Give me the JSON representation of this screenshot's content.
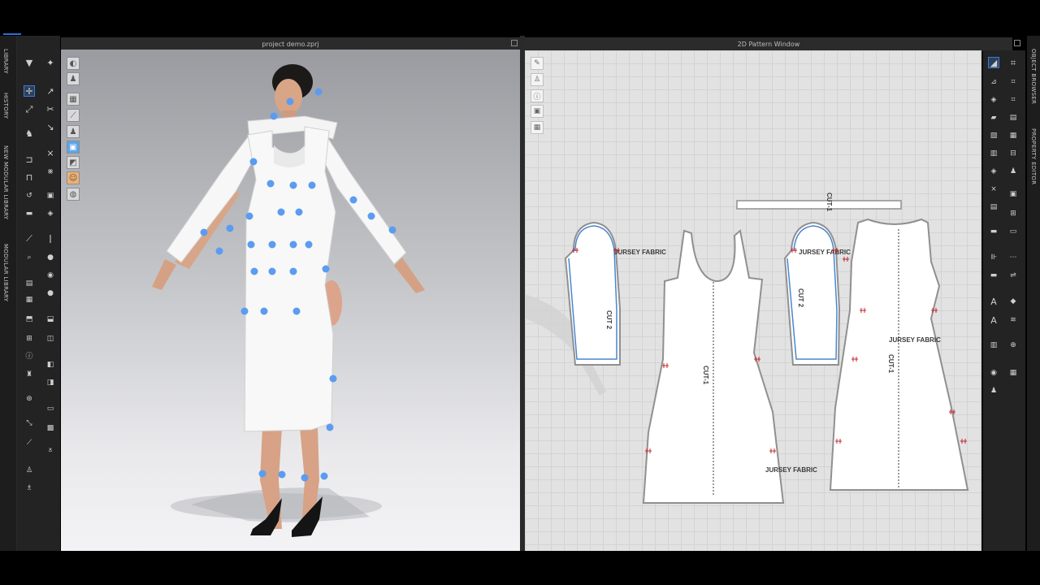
{
  "left_tabs": [
    "LIBRARY",
    "HISTORY",
    "NEW MODULAR LIBRARY",
    "MODULAR LIBRARY"
  ],
  "right_tabs": [
    "OBJECT BROWSER",
    "PROPERTY EDITOR"
  ],
  "viewport3d": {
    "title": "project demo.zprj"
  },
  "pattern_window": {
    "title": "2D Pattern Window",
    "labels": {
      "collar_cut": "CUT-1",
      "left_sleeve_fabric": "JURSEY FABRIC",
      "left_sleeve_cut": "CUT 2",
      "front_cut": "CUT-1",
      "front_fabric": "JURSEY FABRIC",
      "right_sleeve_fabric": "JURSEY FABRIC",
      "right_sleeve_cut": "CUT 2",
      "back_fabric": "JURSEY FABRIC",
      "back_cut": "CUT-1"
    }
  },
  "icons": {
    "left_toolbar": [
      "move-down-icon",
      "avatar-pose-icon",
      "select-move-icon",
      "transform-icon",
      "edit-pattern-icon",
      "fold-icon",
      "tack-icon",
      "pin-icon",
      "shirt-icon",
      "seam-icon",
      "measure-icon",
      "ruler-icon",
      "layer-icon",
      "strength-icon",
      "fold-arrange-icon",
      "flatten-icon",
      "line-icon",
      "brush-icon",
      "stitch-icon",
      "sew-icon",
      "zip-icon",
      "button-icon",
      "hanger-icon",
      "texture-icon",
      "topstitch-icon",
      "trim-icon",
      "wind-icon",
      "shading-icon",
      "pen-icon",
      "scale-icon",
      "cut-icon",
      "knife-icon",
      "shirt-small-icon",
      "garment-icon"
    ],
    "viewport_tools": [
      "shaded-view-icon",
      "avatar-view-icon",
      "fabric-view-icon",
      "thickness-icon",
      "pressure-icon",
      "arrangement-icon",
      "fitting-icon",
      "strain-icon",
      "skin-icon",
      "world-icon"
    ],
    "pattern_tools": [
      "pencil-icon",
      "shirt-view-icon",
      "info-icon",
      "pattern-copy-icon",
      "pattern-grid-icon"
    ],
    "right_toolbar": [
      "select-icon",
      "bookmark-icon",
      "edit-point-icon",
      "curve-icon",
      "segment-icon",
      "trace-icon",
      "folder-icon",
      "symmetry-icon",
      "image-icon",
      "printer-icon",
      "internal-line-icon",
      "dart-icon",
      "rectangle-icon",
      "circle-icon",
      "cut-pattern-icon",
      "grading-icon",
      "notch-icon",
      "seamline-icon",
      "text-icon",
      "annotation-icon",
      "font-icon",
      "wavy-icon",
      "barcode-icon",
      "stamp-icon",
      "avatar-icon",
      "calendar-icon"
    ]
  },
  "colors": {
    "pin_blue": "#5b9cf0",
    "seam_blue": "#4a86d0",
    "notch_red": "#c0282c",
    "fabric_white": "#ffffff"
  }
}
